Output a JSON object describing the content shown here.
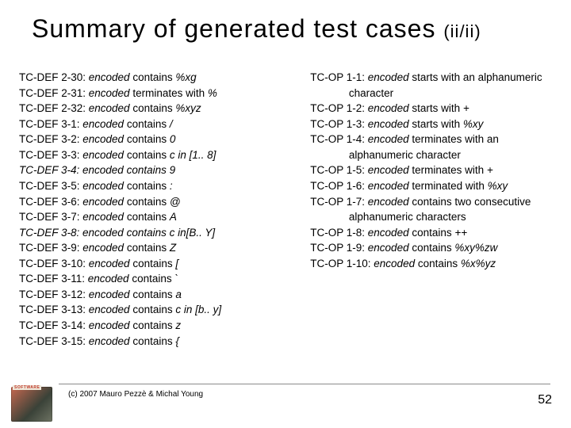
{
  "title": "Summary of generated test cases",
  "title_suffix": "(ii/ii)",
  "left": [
    {
      "id": "TC-DEF 2-30:",
      "em": "encoded ",
      "plain": "contains ",
      "tail": "%xg",
      "tail_em": true,
      "all_italic": false
    },
    {
      "id": "TC-DEF 2-31:",
      "em": "encoded ",
      "plain": "terminates with ",
      "tail": "%",
      "tail_em": true,
      "all_italic": false
    },
    {
      "id": "TC-DEF 2-32:",
      "em": "encoded ",
      "plain": "contains ",
      "tail": "%xyz",
      "tail_em": true,
      "all_italic": false
    },
    {
      "id": "TC-DEF 3-1:",
      "em": "encoded ",
      "plain": " contains ",
      "tail": "/",
      "tail_em": true,
      "all_italic": false
    },
    {
      "id": "TC-DEF 3-2:",
      "em": "encoded ",
      "plain": "contains ",
      "tail": "0",
      "tail_em": true,
      "all_italic": false
    },
    {
      "id": "TC-DEF 3-3:",
      "em": "encoded ",
      "plain": "contains ",
      "tail": "c in [1.. 8]",
      "tail_em": true,
      "all_italic": false
    },
    {
      "id": "TC-DEF 3-4:",
      "em": "encoded ",
      "plain": "contains ",
      "tail": "9",
      "tail_em": true,
      "all_italic": true
    },
    {
      "id": "TC-DEF 3-5:",
      "em": "encoded ",
      "plain": "contains ",
      "tail": ":",
      "tail_em": true,
      "all_italic": false
    },
    {
      "id": "TC-DEF 3-6:",
      "em": "encoded ",
      "plain": "contains ",
      "tail": "@",
      "tail_em": true,
      "all_italic": false
    },
    {
      "id": "TC-DEF 3-7:",
      "em": "encoded ",
      "plain": "contains ",
      "tail": "A",
      "tail_em": true,
      "all_italic": false
    },
    {
      "id": "TC-DEF 3-8:",
      "em": "encoded ",
      "plain": "contains ",
      "tail": "c in[B.. Y]",
      "tail_em": true,
      "all_italic": true
    },
    {
      "id": "TC-DEF 3-9:",
      "em": "encoded ",
      "plain": "contains ",
      "tail": "Z",
      "tail_em": true,
      "all_italic": false
    },
    {
      "id": "TC-DEF 3-10:",
      "em": "encoded ",
      "plain": "contains ",
      "tail": "[",
      "tail_em": true,
      "all_italic": false
    },
    {
      "id": "TC-DEF 3-11:",
      "em": "encoded ",
      "plain": "contains ",
      "tail": "`",
      "tail_em": true,
      "all_italic": false
    },
    {
      "id": "TC-DEF 3-12:",
      "em": "encoded ",
      "plain": "contains ",
      "tail": "a",
      "tail_em": true,
      "all_italic": false
    },
    {
      "id": "TC-DEF 3-13:",
      "em": "encoded ",
      "plain": "contains ",
      "tail": "c in [b.. y]",
      "tail_em": true,
      "all_italic": false
    },
    {
      "id": "TC-DEF 3-14:",
      "em": "encoded ",
      "plain": "contains ",
      "tail": "z",
      "tail_em": true,
      "all_italic": false
    },
    {
      "id": "TC-DEF 3-15:",
      "em": "encoded ",
      "plain": "contains ",
      "tail": "{",
      "tail_em": true,
      "all_italic": false
    }
  ],
  "right": [
    {
      "id": "TC-OP 1-1:",
      "em": "encoded ",
      "plain": "starts with an alphanumeric character",
      "tail": "",
      "tail_em": false
    },
    {
      "id": "TC-OP 1-2:",
      "em": "encoded ",
      "plain": "starts with ",
      "tail": "+",
      "tail_em": true
    },
    {
      "id": "TC-OP 1-3:",
      "em": "encoded ",
      "plain": "starts with ",
      "tail": "%xy",
      "tail_em": true
    },
    {
      "id": "TC-OP 1-4:",
      "em": "encoded ",
      "plain": "terminates with an alphanumeric character",
      "tail": "",
      "tail_em": false
    },
    {
      "id": "TC-OP 1-5:",
      "em": "encoded ",
      "plain": "terminates with ",
      "tail": "+",
      "tail_em": true
    },
    {
      "id": "TC-OP 1-6:",
      "em": "encoded ",
      "plain": "terminated with ",
      "tail": "%xy",
      "tail_em": true
    },
    {
      "id": "TC-OP 1-7:",
      "em": "encoded ",
      "plain": "contains two consecutive alphanumeric characters",
      "tail": "",
      "tail_em": false
    },
    {
      "id": "TC-OP 1-8:",
      "em": "encoded ",
      "plain": "contains ",
      "tail": "++",
      "tail_em": true
    },
    {
      "id": "TC-OP 1-9:",
      "em": "encoded ",
      "plain": "contains ",
      "tail": "%xy%zw",
      "tail_em": true
    },
    {
      "id": "TC-OP 1-10:",
      "em": "encoded ",
      "plain": "contains ",
      "tail": "%x%yz",
      "tail_em": true
    }
  ],
  "footer": {
    "copyright": "(c) 2007 Mauro Pezzè & Michal Young",
    "page": "52"
  }
}
